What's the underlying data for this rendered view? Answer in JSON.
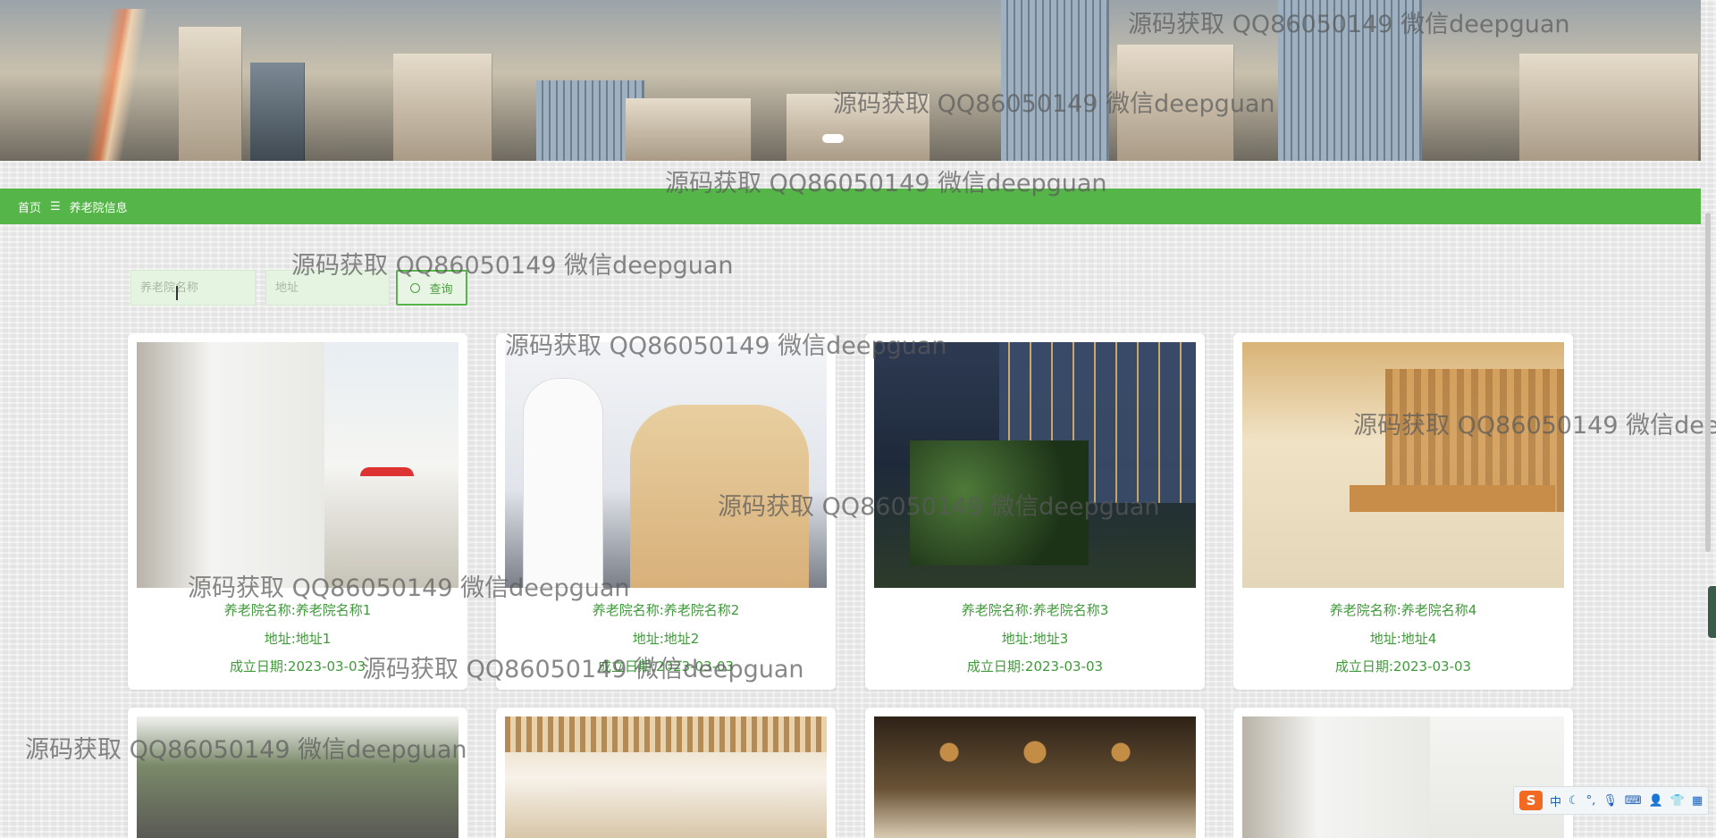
{
  "breadcrumb": {
    "home": "首页",
    "separator": "☰",
    "current": "养老院信息"
  },
  "search": {
    "name_placeholder": "养老院名称",
    "address_placeholder": "地址",
    "button_label": "查询"
  },
  "cards": [
    {
      "name": "养老院名称:养老院名称1",
      "address": "地址:地址1",
      "date": "成立日期:2023-03-03"
    },
    {
      "name": "养老院名称:养老院名称2",
      "address": "地址:地址2",
      "date": "成立日期:2023-03-03"
    },
    {
      "name": "养老院名称:养老院名称3",
      "address": "地址:地址3",
      "date": "成立日期:2023-03-03"
    },
    {
      "name": "养老院名称:养老院名称4",
      "address": "地址:地址4",
      "date": "成立日期:2023-03-03"
    },
    {
      "name": "",
      "address": "",
      "date": ""
    },
    {
      "name": "",
      "address": "",
      "date": ""
    },
    {
      "name": "",
      "address": "",
      "date": ""
    },
    {
      "name": "",
      "address": "",
      "date": ""
    }
  ],
  "watermark": "源码获取 QQ86050149 微信deepguan",
  "ime": {
    "logo": "S",
    "mode": "中",
    "icons": [
      "moon-icon",
      "punctuation-icon",
      "microphone-icon",
      "keyboard-icon",
      "user-icon",
      "skin-icon",
      "grid-icon"
    ]
  },
  "colors": {
    "accent": "#56b549",
    "text_green": "#3f9a3a"
  }
}
